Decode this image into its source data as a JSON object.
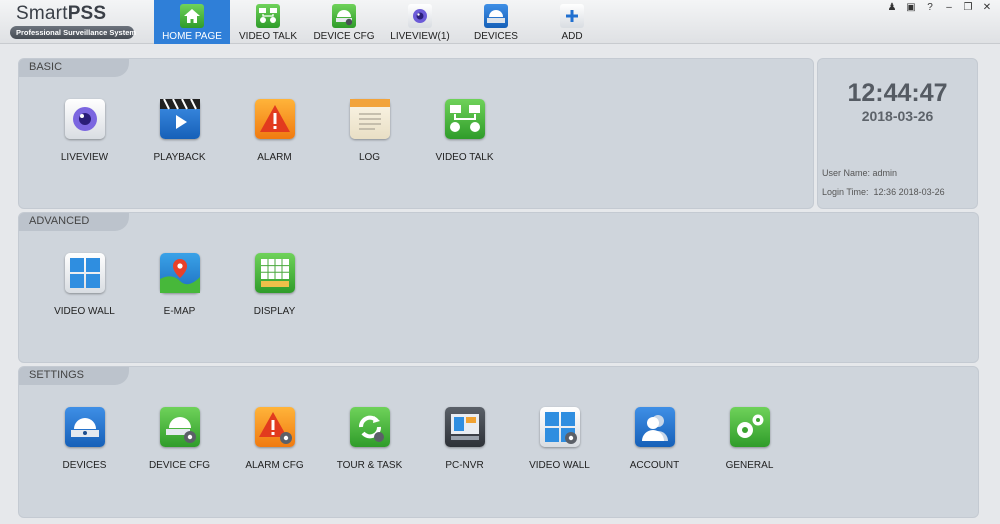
{
  "app": {
    "logo_main": "Smart",
    "logo_bold": "PSS",
    "logo_sub": "Professional Surveillance System"
  },
  "tabs": [
    {
      "label": "HOME PAGE",
      "icon": "home-icon",
      "active": true
    },
    {
      "label": "VIDEO TALK",
      "icon": "video-talk-icon"
    },
    {
      "label": "DEVICE CFG",
      "icon": "device-cfg-icon"
    },
    {
      "label": "LIVEVIEW(1)",
      "icon": "liveview-icon"
    },
    {
      "label": "DEVICES",
      "icon": "devices-icon"
    },
    {
      "label": "ADD",
      "icon": "add-icon"
    }
  ],
  "window_controls": [
    "user-icon",
    "lock-icon",
    "help-icon",
    "minimize-icon",
    "restore-icon",
    "close-icon"
  ],
  "basic": {
    "title": "BASIC",
    "items": [
      {
        "label": "LIVEVIEW",
        "icon": "liveview-camera-icon"
      },
      {
        "label": "PLAYBACK",
        "icon": "playback-icon"
      },
      {
        "label": "ALARM",
        "icon": "alarm-icon"
      },
      {
        "label": "LOG",
        "icon": "log-icon"
      },
      {
        "label": "VIDEO TALK",
        "icon": "video-talk-icon"
      }
    ]
  },
  "advanced": {
    "title": "ADVANCED",
    "items": [
      {
        "label": "VIDEO WALL",
        "icon": "video-wall-icon"
      },
      {
        "label": "E-MAP",
        "icon": "emap-icon"
      },
      {
        "label": "DISPLAY",
        "icon": "display-icon"
      }
    ]
  },
  "settings": {
    "title": "SETTINGS",
    "items": [
      {
        "label": "DEVICES",
        "icon": "devices-icon"
      },
      {
        "label": "DEVICE CFG",
        "icon": "device-cfg-icon"
      },
      {
        "label": "ALARM CFG",
        "icon": "alarm-cfg-icon"
      },
      {
        "label": "TOUR & TASK",
        "icon": "tour-task-icon"
      },
      {
        "label": "PC-NVR",
        "icon": "pc-nvr-icon"
      },
      {
        "label": "VIDEO WALL",
        "icon": "video-wall-cfg-icon"
      },
      {
        "label": "ACCOUNT",
        "icon": "account-icon"
      },
      {
        "label": "GENERAL",
        "icon": "general-icon"
      }
    ]
  },
  "clock": {
    "time": "12:44:47",
    "date": "2018-03-26",
    "user_label": "User Name:",
    "user_name": "admin",
    "login_label": "Login Time:",
    "login_time": "12:36 2018-03-26"
  },
  "colors": {
    "active_tab": "#2f7fd8",
    "panel": "#cfd5dc",
    "background": "#e6e8eb"
  }
}
